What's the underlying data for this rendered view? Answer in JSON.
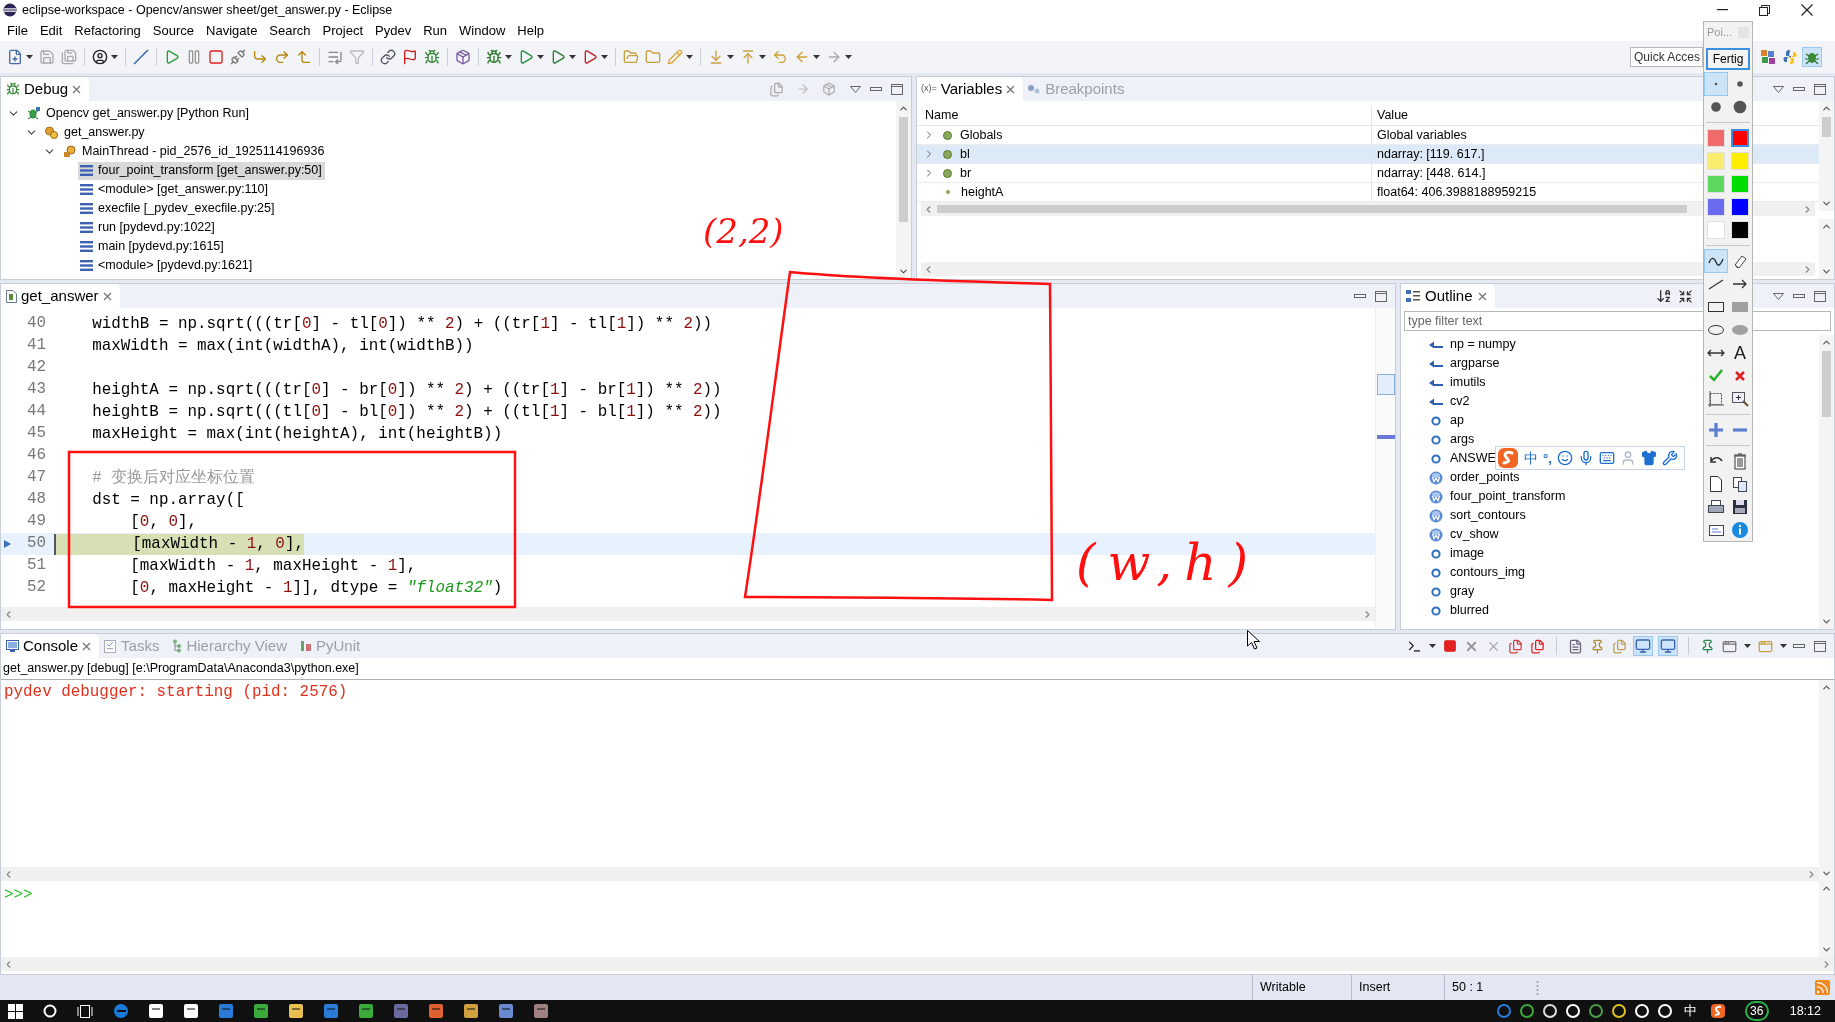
{
  "window": {
    "title": "eclipse-workspace - Opencv/answer sheet/get_answer.py - Eclipse"
  },
  "menu": [
    "File",
    "Edit",
    "Refactoring",
    "Source",
    "Navigate",
    "Search",
    "Project",
    "Pydev",
    "Run",
    "Window",
    "Help"
  ],
  "toolbar": {
    "quick_access": {
      "placeholder": "Quick Acces"
    },
    "perspectives": [
      {
        "kind": "blocks",
        "selected": false
      },
      {
        "kind": "snake",
        "selected": false
      },
      {
        "kind": "bug",
        "selected": true
      }
    ]
  },
  "debug_view": {
    "tab": "Debug",
    "tree": [
      {
        "label": "Opencv get_answer.py [Python Run]",
        "kind": "launch",
        "expanded": true,
        "children": [
          {
            "label": "get_answer.py",
            "kind": "process",
            "expanded": true,
            "children": [
              {
                "label": "MainThread - pid_2576_id_1925114196936",
                "kind": "thread",
                "expanded": true,
                "children": [
                  {
                    "label": "four_point_transform [get_answer.py:50]",
                    "kind": "frame",
                    "selected": true
                  },
                  {
                    "label": "<module> [get_answer.py:110]",
                    "kind": "frame",
                    "selected": false
                  },
                  {
                    "label": "execfile [_pydev_execfile.py:25]",
                    "kind": "frame",
                    "selected": false
                  },
                  {
                    "label": "run [pydevd.py:1022]",
                    "kind": "frame",
                    "selected": false
                  },
                  {
                    "label": "main [pydevd.py:1615]",
                    "kind": "frame",
                    "selected": false
                  },
                  {
                    "label": "<module> [pydevd.py:1621]",
                    "kind": "frame",
                    "selected": false
                  }
                ]
              }
            ]
          }
        ]
      }
    ]
  },
  "variables_view": {
    "tabs": [
      {
        "label": "Variables",
        "glyph": "(x)=",
        "selected": true
      },
      {
        "label": "Breakpoints",
        "selected": false
      }
    ],
    "columns": [
      "Name",
      "Value"
    ],
    "rows": [
      {
        "name": "Globals",
        "value": "Global variables",
        "expandable": true,
        "selected": false
      },
      {
        "name": "bl",
        "value": "ndarray: [119. 617.]",
        "expandable": true,
        "selected": true
      },
      {
        "name": "br",
        "value": "ndarray: [448. 614.]",
        "expandable": true,
        "selected": false
      },
      {
        "name": "heightA",
        "value": "float64: 406.3988188959215",
        "expandable": false,
        "selected": false
      }
    ]
  },
  "editor": {
    "tab": "get_answer",
    "lines": [
      {
        "number": "40",
        "code": "    widthB = np.sqrt(((tr[0] - tl[0]) ** 2) + ((tr[1] - tl[1]) ** 2))",
        "current": false
      },
      {
        "number": "41",
        "code": "    maxWidth = max(int(widthA), int(widthB))",
        "current": false
      },
      {
        "number": "42",
        "current": false
      },
      {
        "number": "43",
        "code": "    heightA = np.sqrt(((tr[0] - br[0]) ** 2) + ((tr[1] - br[1]) ** 2))",
        "current": false
      },
      {
        "number": "44",
        "code": "    heightB = np.sqrt(((tl[0] - bl[0]) ** 2) + ((tl[1] - bl[1]) ** 2))",
        "current": false
      },
      {
        "number": "45",
        "code": "    maxHeight = max(int(heightA), int(heightB))",
        "current": false
      },
      {
        "number": "46",
        "current": false
      },
      {
        "number": "47",
        "code": "    # 变换后对应坐标位置",
        "current": false
      },
      {
        "number": "48",
        "code": "    dst = np.array([",
        "current": false
      },
      {
        "number": "49",
        "code": "        [0, 0],",
        "current": false
      },
      {
        "number": "50",
        "code": "        [maxWidth - 1, 0],",
        "current": true
      },
      {
        "number": "51",
        "code": "        [maxWidth - 1, maxHeight - 1],",
        "current": false
      },
      {
        "number": "52",
        "code": "        [0, maxHeight - 1]], dtype = \"float32\")",
        "current": false
      }
    ]
  },
  "outline": {
    "tab": "Outline",
    "filter": {
      "placeholder": "type filter text"
    },
    "items": [
      {
        "label": "np = numpy",
        "kind": "import"
      },
      {
        "label": "argparse",
        "kind": "import"
      },
      {
        "label": "imutils",
        "kind": "import"
      },
      {
        "label": "cv2",
        "kind": "import"
      },
      {
        "label": "ap",
        "kind": "variable"
      },
      {
        "label": "args",
        "kind": "variable"
      },
      {
        "label": "ANSWE",
        "kind": "variable"
      },
      {
        "label": "order_points",
        "kind": "function"
      },
      {
        "label": "four_point_transform",
        "kind": "function"
      },
      {
        "label": "sort_contours",
        "kind": "function"
      },
      {
        "label": "cv_show",
        "kind": "function"
      },
      {
        "label": "image",
        "kind": "variable"
      },
      {
        "label": "contours_img",
        "kind": "variable"
      },
      {
        "label": "gray",
        "kind": "variable"
      },
      {
        "label": "blurred",
        "kind": "variable"
      }
    ]
  },
  "console": {
    "tabs": [
      {
        "label": "Console",
        "selected": true
      },
      {
        "label": "Tasks",
        "selected": false
      },
      {
        "label": "Hierarchy View",
        "selected": false
      },
      {
        "label": "PyUnit",
        "selected": false
      }
    ],
    "toggles": [
      {
        "on": true
      },
      {
        "on": true
      }
    ],
    "process": "get_answer.py [debug] [e:\\ProgramData\\Anaconda3\\python.exe]",
    "output": [
      {
        "text": "pydev debugger: starting (pid: 2576)",
        "kind": "stderr"
      }
    ],
    "prompt": ">>>"
  },
  "status_bar": {
    "fields": [
      "Writable",
      "Insert",
      "50 : 1"
    ]
  },
  "taskbar": {
    "input_mode": "中",
    "badge": "36",
    "clock": "18:12"
  },
  "annotation_palette": {
    "title": "Poi...",
    "done_button": "Fertig",
    "sizes": [
      {
        "selected": true
      },
      {
        "selected": false
      },
      {
        "selected": false
      },
      {
        "selected": false
      }
    ],
    "colors": [
      {
        "color": "#f26b6b",
        "selected": false
      },
      {
        "color": "#ff0000",
        "selected": true
      },
      {
        "color": "#f7ec6e",
        "selected": false
      },
      {
        "color": "#ffee00",
        "selected": false
      },
      {
        "color": "#5fd85f",
        "selected": false
      },
      {
        "color": "#00dd00",
        "selected": false
      },
      {
        "color": "#6b6bf0",
        "selected": false
      },
      {
        "color": "#0000ff",
        "selected": false
      },
      {
        "color": "#ffffff",
        "selected": false
      },
      {
        "color": "#000000",
        "selected": false
      }
    ],
    "tool_groups": [
      {
        "tools": [
          {
            "kind": "pen",
            "selected": true
          },
          {
            "kind": "eraser",
            "selected": false
          },
          {
            "kind": "line",
            "selected": false
          },
          {
            "kind": "arrow",
            "selected": false
          },
          {
            "kind": "rectangle",
            "selected": false
          },
          {
            "kind": "filled-rectangle",
            "selected": false
          },
          {
            "kind": "ellipse",
            "selected": false
          },
          {
            "kind": "filled-ellipse",
            "selected": false
          },
          {
            "kind": "double-arrow",
            "selected": false
          },
          {
            "kind": "text",
            "glyph": "A",
            "selected": false
          },
          {
            "kind": "check",
            "selected": false
          },
          {
            "kind": "cross",
            "selected": false
          },
          {
            "kind": "crop",
            "selected": false
          },
          {
            "kind": "zoom",
            "selected": false
          }
        ]
      },
      {
        "tools": [
          {
            "kind": "plus",
            "selected": false
          },
          {
            "kind": "minus",
            "selected": false
          }
        ]
      },
      {
        "tools": [
          {
            "kind": "undo",
            "selected": false
          },
          {
            "kind": "trash",
            "selected": false
          },
          {
            "kind": "page",
            "selected": false
          },
          {
            "kind": "copy",
            "selected": false
          },
          {
            "kind": "print",
            "selected": false
          },
          {
            "kind": "save",
            "selected": false
          },
          {
            "kind": "screen",
            "selected": false
          },
          {
            "kind": "info",
            "selected": false
          }
        ]
      }
    ]
  },
  "ime_toolbar": {
    "mode": "中",
    "punctuation": "°,"
  },
  "annotations": [
    {
      "kind": "note",
      "text": "(2,2)"
    },
    {
      "kind": "frame"
    },
    {
      "kind": "box"
    },
    {
      "kind": "note",
      "text": "(w,h)"
    }
  ]
}
